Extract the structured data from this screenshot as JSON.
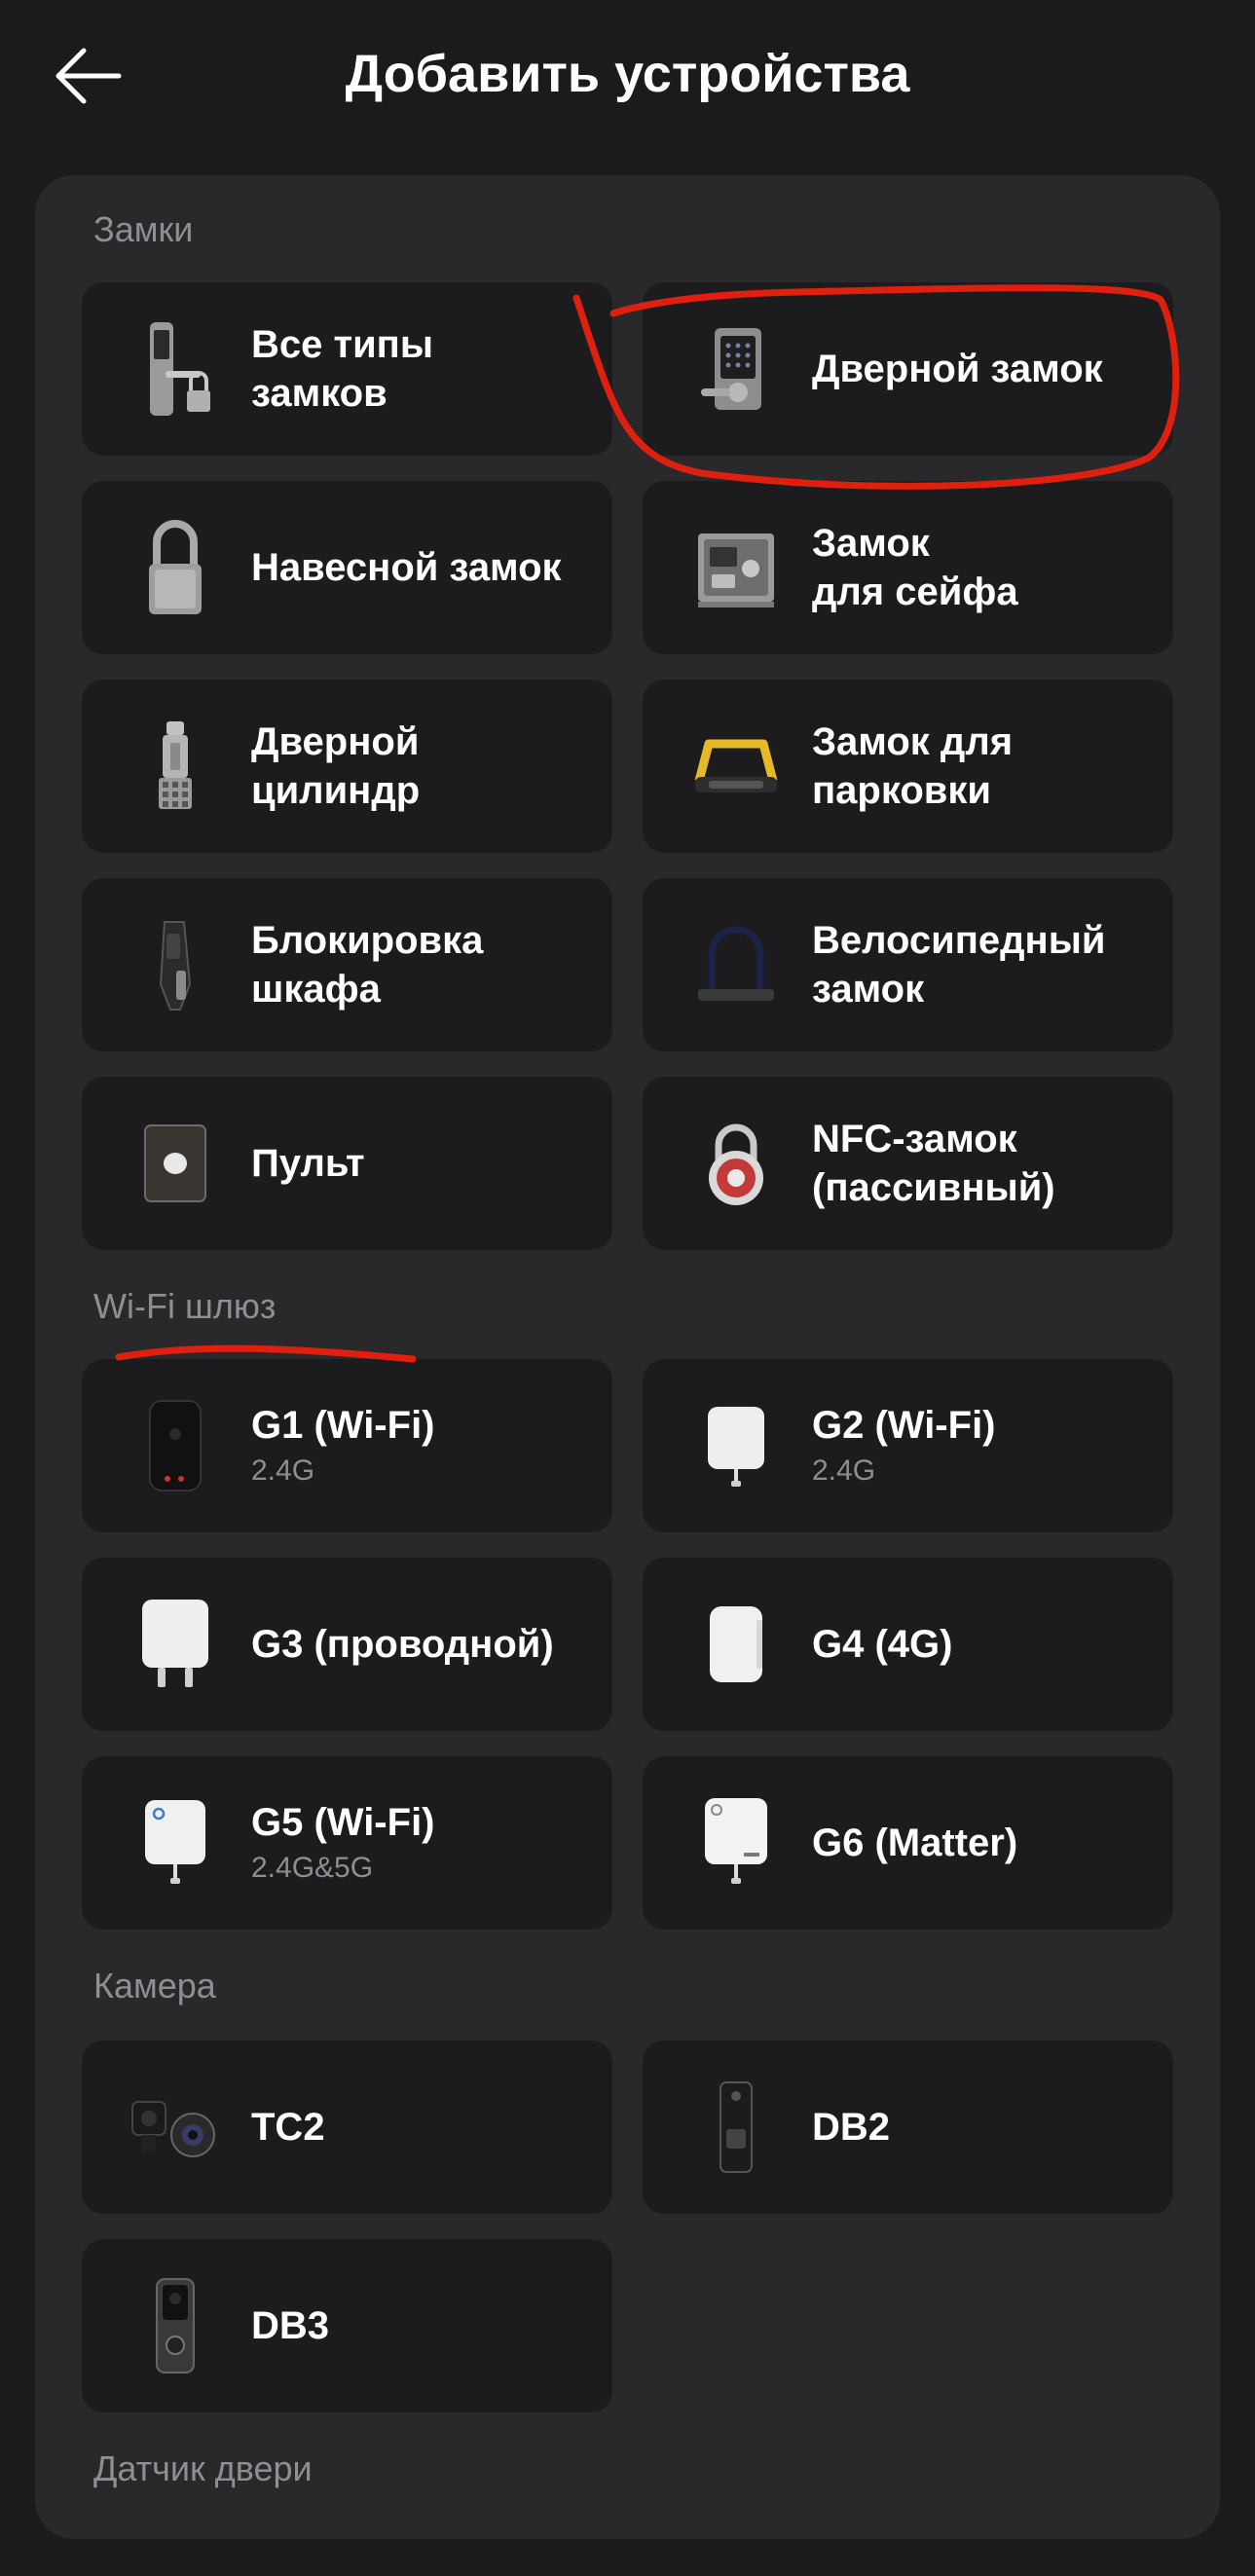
{
  "header": {
    "title": "Добавить устройства"
  },
  "sections": {
    "locks": "Замки",
    "gateway": "Wi-Fi шлюз",
    "camera": "Камера",
    "door_sensor": "Датчик двери"
  },
  "tiles": {
    "all_locks": {
      "name": "Все типы\nзамков",
      "icon": "door-lock-with-padlock-icon"
    },
    "door_lock": {
      "name": "Дверной замок",
      "icon": "keypad-deadbolt-icon"
    },
    "padlock": {
      "name": "Навесной замок",
      "icon": "padlock-icon"
    },
    "safe_lock": {
      "name": "Замок\nдля сейфа",
      "icon": "safe-icon"
    },
    "door_cylinder": {
      "name": "Дверной\nцилиндр",
      "icon": "cylinder-icon"
    },
    "parking_lock": {
      "name": "Замок для\nпарковки",
      "icon": "parking-barrier-icon"
    },
    "cabinet_lock": {
      "name": "Блокировка\nшкафа",
      "icon": "cabinet-lock-icon"
    },
    "bike_lock": {
      "name": "Велосипедный\nзамок",
      "icon": "u-lock-icon"
    },
    "remote": {
      "name": "Пульт",
      "icon": "remote-button-icon"
    },
    "nfc_lock": {
      "name": "NFC-замок\n(пассивный)",
      "icon": "nfc-padlock-icon"
    },
    "g1": {
      "name": "G1 (Wi-Fi)",
      "sub": "2.4G",
      "icon": "gateway-g1-icon"
    },
    "g2": {
      "name": "G2 (Wi-Fi)",
      "sub": "2.4G",
      "icon": "gateway-g2-icon"
    },
    "g3": {
      "name": "G3 (проводной)",
      "icon": "gateway-g3-icon"
    },
    "g4": {
      "name": "G4 (4G)",
      "icon": "gateway-g4-icon"
    },
    "g5": {
      "name": "G5 (Wi-Fi)",
      "sub": "2.4G&5G",
      "icon": "gateway-g5-icon"
    },
    "g6": {
      "name": "G6 (Matter)",
      "icon": "gateway-g6-icon"
    },
    "tc2": {
      "name": "TC2",
      "icon": "camera-tc2-icon"
    },
    "db2": {
      "name": "DB2",
      "icon": "doorbell-db2-icon"
    },
    "db3": {
      "name": "DB3",
      "icon": "doorbell-db3-icon"
    }
  },
  "colors": {
    "background": "#1b1b1d",
    "panel": "#29292c",
    "tile": "#1c1c1e",
    "section_text": "#8e8e93",
    "annotation_red": "#e0200f"
  }
}
